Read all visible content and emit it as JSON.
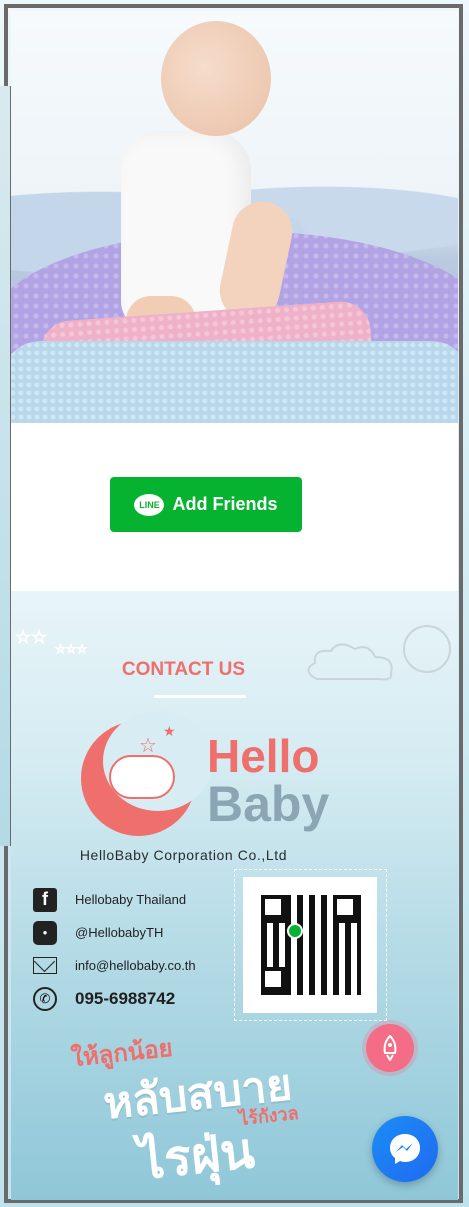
{
  "line_button": {
    "icon_text": "LINE",
    "label": "Add Friends"
  },
  "contact": {
    "title": "CONTACT US",
    "logo": {
      "line1": "Hello",
      "line2": "Baby"
    },
    "company": "HelloBaby Corporation Co.,Ltd",
    "items": [
      {
        "icon": "facebook-icon",
        "text": "Hellobaby Thailand"
      },
      {
        "icon": "line-icon",
        "text": "@HellobabyTH"
      },
      {
        "icon": "mail-icon",
        "text": "info@hellobaby.co.th"
      },
      {
        "icon": "phone-icon",
        "text": "095-6988742"
      }
    ],
    "slogan": {
      "line1": "ให้ลูกน้อย",
      "line2": "หลับสบาย",
      "line3": "ไร้กังวล",
      "line4": "ไรฝุ่น"
    }
  },
  "floating": {
    "rocket_icon": "rocket-icon",
    "messenger_icon": "messenger-icon"
  },
  "colors": {
    "line_green": "#06b330",
    "brand_coral": "#ef6f6c",
    "brand_grey_blue": "#8aa6b3",
    "messenger_blue": "#1c8cf6"
  }
}
